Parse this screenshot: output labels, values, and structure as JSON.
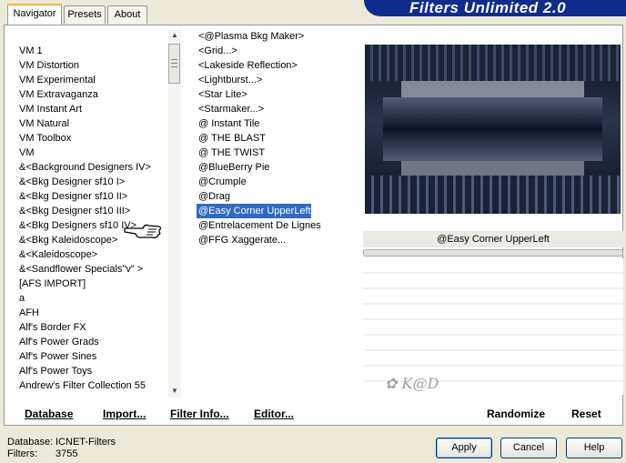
{
  "tabs": [
    "Navigator",
    "Presets",
    "About"
  ],
  "banner_title": "Filters Unlimited 2.0",
  "categories": [
    "VM 1",
    "VM Distortion",
    "VM Experimental",
    "VM Extravaganza",
    "VM Instant Art",
    "VM Natural",
    "VM Toolbox",
    "VM",
    "&<Background Designers IV>",
    "&<Bkg Designer sf10 I>",
    "&<Bkg Designer sf10 II>",
    "&<Bkg Designer sf10 III>",
    "&<Bkg Designers sf10 IV>",
    "&<Bkg Kaleidoscope>",
    "&<Kaleidoscope>",
    "&<Sandflower Specials\"v\" >",
    "[AFS IMPORT]",
    "a",
    "AFH",
    "Alf's Border FX",
    "Alf's Power Grads",
    "Alf's Power Sines",
    "Alf's Power Toys",
    "Andrew's Filter Collection 55"
  ],
  "filters": [
    "<@Plasma Bkg Maker>",
    "<Grid...>",
    "<Lakeside Reflection>",
    "<Lightburst...>",
    "<Star Lite>",
    "<Starmaker...>",
    "@ Instant Tile",
    "@ THE BLAST",
    "@ THE TWIST",
    "@BlueBerry Pie",
    "@Crumple",
    "@Drag",
    "@Easy Corner UpperLeft",
    "@Entrelacement De Lignes",
    "@FFG Xaggerate..."
  ],
  "selected_filter_index": 12,
  "preview_filter_name": "@Easy Corner UpperLeft",
  "watermark_text": "K@D",
  "panel_buttons": {
    "database": "Database",
    "import": "Import...",
    "filter_info": "Filter Info...",
    "editor": "Editor...",
    "randomize": "Randomize",
    "reset": "Reset"
  },
  "status": {
    "database_label": "Database:",
    "database_value": "ICNET-Filters",
    "filters_label": "Filters:",
    "filters_value": "3755"
  },
  "dialog_buttons": {
    "apply": "Apply",
    "cancel": "Cancel",
    "help": "Help"
  },
  "icons": {
    "pointer": "pointing-hand-icon",
    "scroll_up": "arrow-up-icon",
    "scroll_down": "arrow-down-icon"
  }
}
